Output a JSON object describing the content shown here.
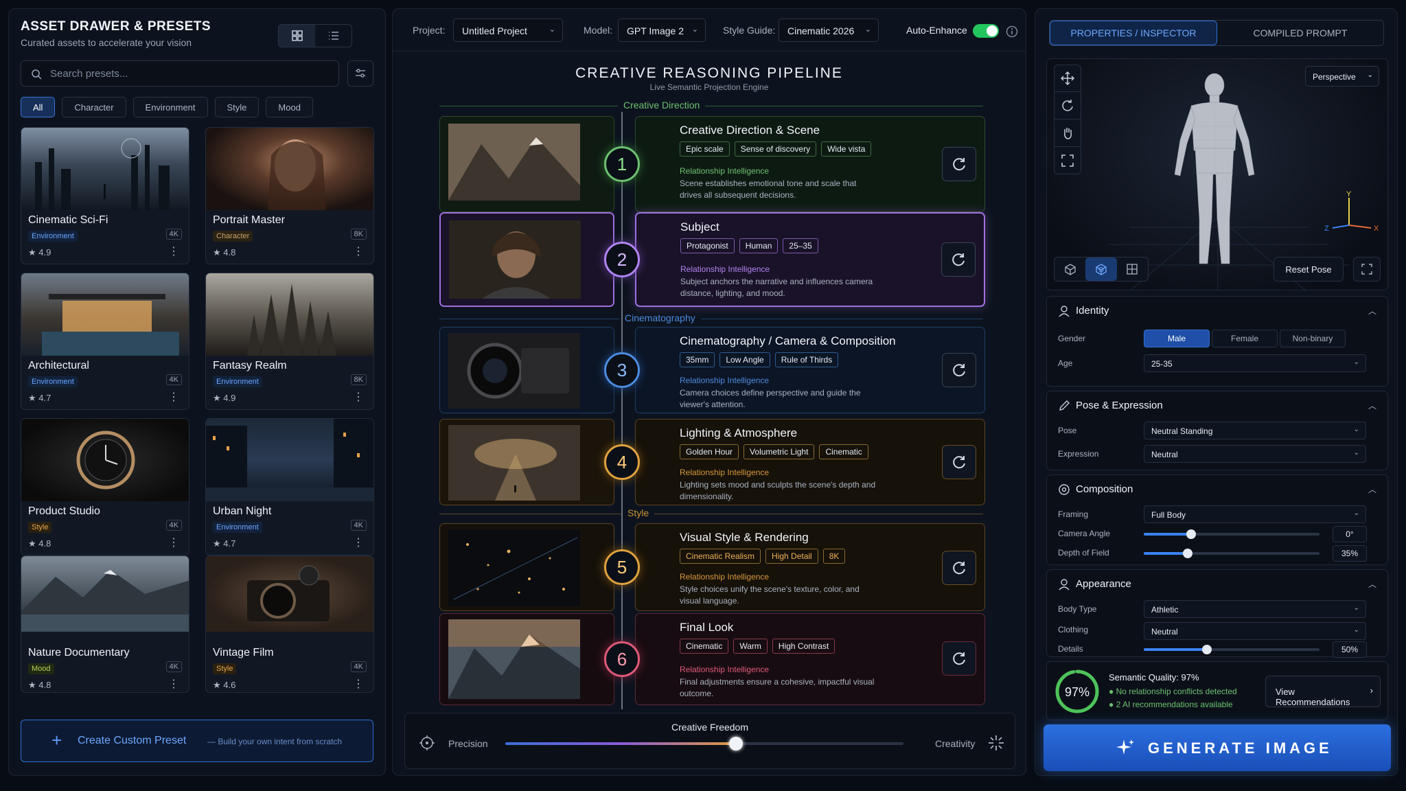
{
  "left": {
    "title": "ASSET DRAWER & PRESETS",
    "subtitle": "Curated assets to accelerate your vision",
    "search_placeholder": "Search presets...",
    "filters": [
      "All",
      "Character",
      "Environment",
      "Style",
      "Mood"
    ],
    "presets": [
      {
        "name": "Cinematic Sci-Fi",
        "tag": "Environment",
        "res": "4K",
        "rating": "4.9"
      },
      {
        "name": "Portrait Master",
        "tag": "Character",
        "res": "8K",
        "rating": "4.8"
      },
      {
        "name": "Architectural",
        "tag": "Environment",
        "res": "4K",
        "rating": "4.7"
      },
      {
        "name": "Fantasy Realm",
        "tag": "Environment",
        "res": "8K",
        "rating": "4.9"
      },
      {
        "name": "Product Studio",
        "tag": "Style",
        "res": "4K",
        "rating": "4.8"
      },
      {
        "name": "Urban Night",
        "tag": "Environment",
        "res": "4K",
        "rating": "4.7"
      },
      {
        "name": "Nature Documentary",
        "tag": "Mood",
        "res": "4K",
        "rating": "4.8"
      },
      {
        "name": "Vintage Film",
        "tag": "Style",
        "res": "4K",
        "rating": "4.6"
      }
    ],
    "create_label": "Create Custom Preset",
    "create_sub": "— Build your own intent from scratch"
  },
  "topbar": {
    "project_label": "Project:",
    "project_value": "Untitled Project",
    "model_label": "Model:",
    "model_value": "GPT Image 2",
    "style_label": "Style Guide:",
    "style_value": "Cinematic 2026",
    "auto_label": "Auto-Enhance"
  },
  "pipeline": {
    "title": "CREATIVE REASONING PIPELINE",
    "subtitle": "Live Semantic Projection Engine",
    "sections": [
      "Creative Direction",
      "Cinematography",
      "Style"
    ],
    "ri_label": "Relationship Intelligence",
    "stages": [
      {
        "num": "1",
        "title": "Creative Direction & Scene",
        "tags": [
          "Epic scale",
          "Sense of discovery",
          "Wide vista"
        ],
        "desc": "Scene establishes emotional tone and scale that drives all subsequent decisions."
      },
      {
        "num": "2",
        "title": "Subject",
        "tags": [
          "Protagonist",
          "Human",
          "25–35"
        ],
        "desc": "Subject anchors the narrative and influences camera distance, lighting, and mood."
      },
      {
        "num": "3",
        "title": "Cinematography / Camera & Composition",
        "tags": [
          "35mm",
          "Low Angle",
          "Rule of Thirds"
        ],
        "desc": "Camera choices define perspective and guide the viewer's attention."
      },
      {
        "num": "4",
        "title": "Lighting & Atmosphere",
        "tags": [
          "Golden Hour",
          "Volumetric Light",
          "Cinematic"
        ],
        "desc": "Lighting sets mood and sculpts the scene's depth and dimensionality."
      },
      {
        "num": "5",
        "title": "Visual Style & Rendering",
        "tags": [
          "Cinematic Realism",
          "High Detail",
          "8K"
        ],
        "desc": "Style choices unify the scene's texture, color, and visual language."
      },
      {
        "num": "6",
        "title": "Final Look",
        "tags": [
          "Cinematic",
          "Warm",
          "High Contrast"
        ],
        "desc": "Final adjustments ensure a cohesive, impactful visual outcome."
      }
    ],
    "freedom_label": "Creative Freedom",
    "precision_label": "Precision",
    "creativity_label": "Creativity",
    "freedom_value": 0.58
  },
  "right": {
    "tabs": [
      "PROPERTIES / INSPECTOR",
      "COMPILED PROMPT"
    ],
    "view_mode": "Perspective",
    "reset_pose": "Reset Pose",
    "identity": {
      "title": "Identity",
      "gender_label": "Gender",
      "genders": [
        "Male",
        "Female",
        "Non-binary"
      ],
      "age_label": "Age",
      "age_value": "25-35"
    },
    "pose": {
      "title": "Pose & Expression",
      "pose_label": "Pose",
      "pose_value": "Neutral Standing",
      "expr_label": "Expression",
      "expr_value": "Neutral"
    },
    "composition": {
      "title": "Composition",
      "framing_label": "Framing",
      "framing_value": "Full Body",
      "angle_label": "Camera Angle",
      "angle_value": "0°",
      "angle_fraction": 0.27,
      "dof_label": "Depth of Field",
      "dof_value": "35%",
      "dof_fraction": 0.25
    },
    "appearance": {
      "title": "Appearance",
      "body_label": "Body Type",
      "body_value": "Athletic",
      "cloth_label": "Clothing",
      "cloth_value": "Neutral",
      "details_label": "Details",
      "details_value": "50%",
      "details_fraction": 0.36
    },
    "quality": {
      "percent": "97%",
      "title": "Semantic Quality: 97%",
      "line1": "No relationship conflicts detected",
      "line2": "2 AI recommendations available",
      "button": "View Recommendations"
    },
    "generate": "GENERATE IMAGE"
  }
}
